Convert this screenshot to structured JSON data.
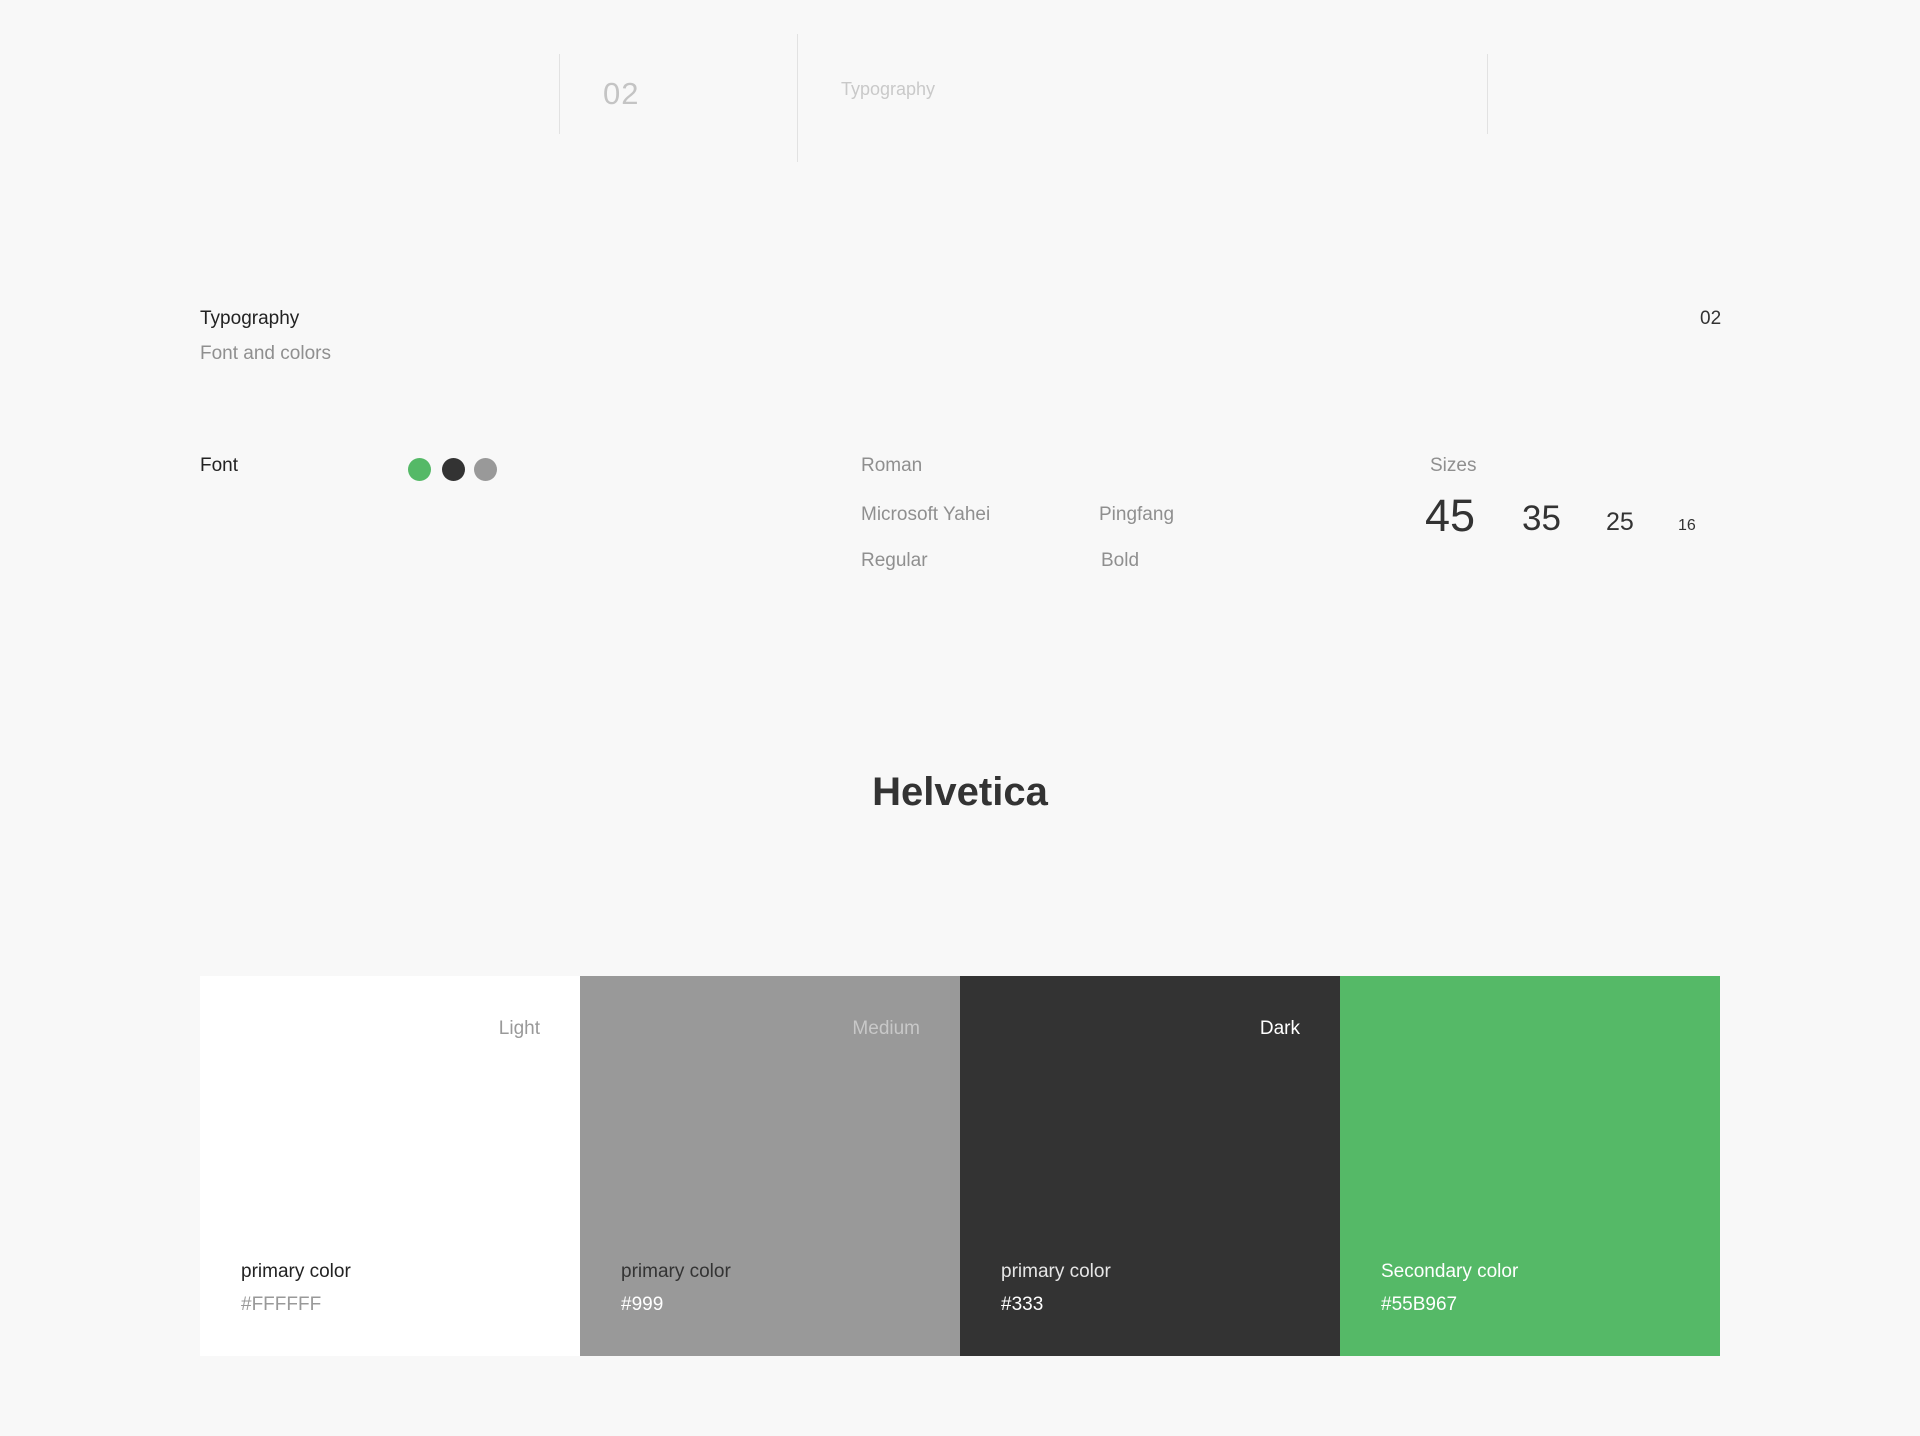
{
  "header": {
    "number": "02",
    "title": "Typography"
  },
  "section": {
    "title": "Typography",
    "subtitle": "Font and colors",
    "number": "02"
  },
  "font_row": {
    "label": "Font",
    "dot_colors": [
      "#55B967",
      "#333333",
      "#999999"
    ],
    "families_label": "Roman",
    "families": [
      "Microsoft Yahei",
      "Pingfang"
    ],
    "weights": [
      "Regular",
      "Bold"
    ],
    "sizes_label": "Sizes",
    "sizes": [
      "45",
      "35",
      "25",
      "16"
    ]
  },
  "featured_font": "Helvetica",
  "swatches": [
    {
      "tag": "Light",
      "name": "primary color",
      "hex": "#FFFFFF",
      "color": "#FFFFFF"
    },
    {
      "tag": "Medium",
      "name": "primary color",
      "hex": "#999",
      "color": "#999999"
    },
    {
      "tag": "Dark",
      "name": "primary color",
      "hex": "#333",
      "color": "#333333"
    },
    {
      "tag": "",
      "name": "Secondary color",
      "hex": "#55B967",
      "color": "#55B967"
    }
  ]
}
